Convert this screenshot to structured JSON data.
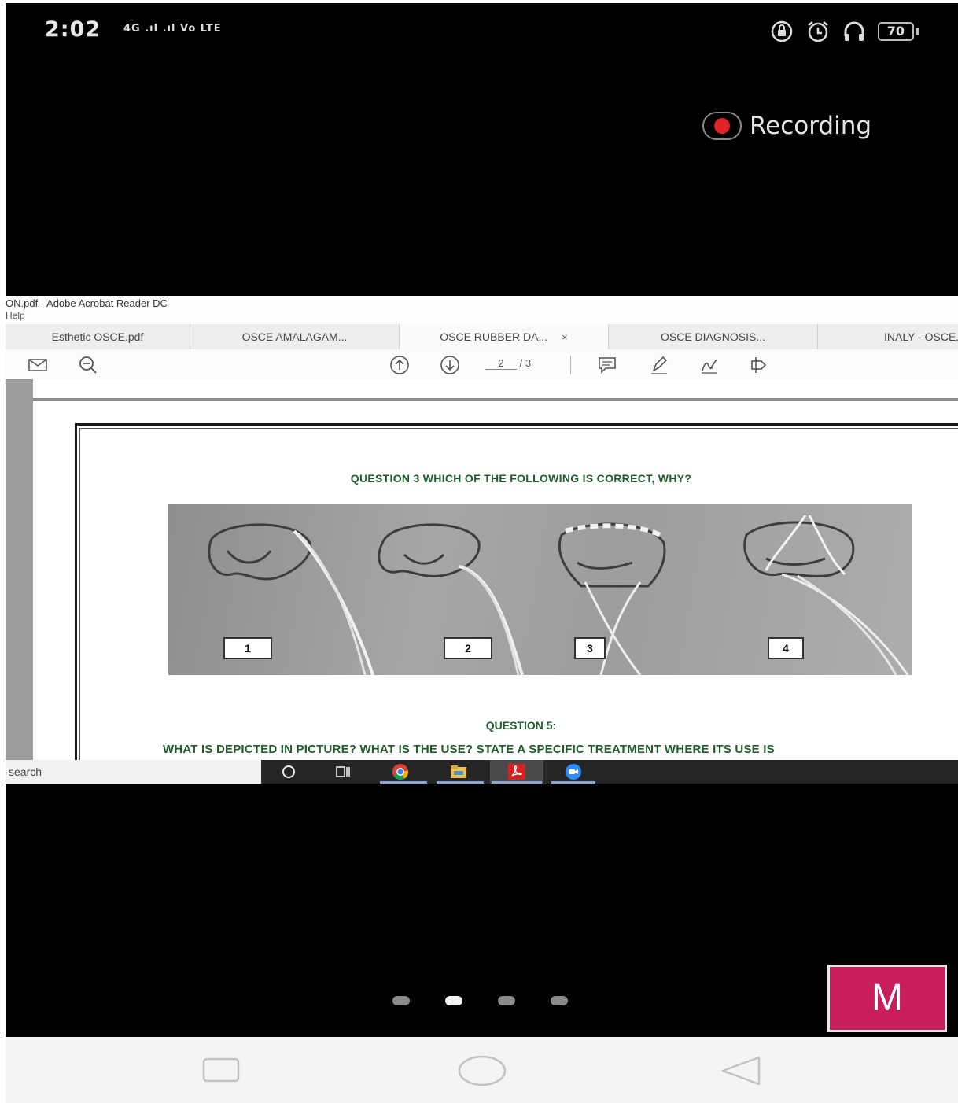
{
  "status_bar": {
    "time": "2:02",
    "signal_text": "4G .ıl .ıl Vo LTE",
    "battery": "70"
  },
  "recording": {
    "label": "Recording",
    "dot_color": "#e02424"
  },
  "window": {
    "title": "ON.pdf - Adobe Acrobat Reader DC",
    "menu": "Help"
  },
  "tabs": [
    {
      "label": "Esthetic OSCE.pdf"
    },
    {
      "label": "OSCE AMALAGAM..."
    },
    {
      "label": "OSCE RUBBER DA...",
      "active": true,
      "close": "×"
    },
    {
      "label": "OSCE DIAGNOSIS..."
    },
    {
      "label": "INALY - OSCE..."
    }
  ],
  "toolbar": {
    "icons": [
      "mail-icon",
      "zoom-out-icon",
      "page-up-icon",
      "page-down-icon",
      "comment-icon",
      "highlight-icon",
      "sign-icon",
      "share-icon"
    ],
    "current_page": "2",
    "total_pages": "/ 3"
  },
  "document": {
    "question3": "QUESTION 3 WHICH OF THE FOLLOWING IS CORRECT, WHY?",
    "image_labels": [
      "1",
      "2",
      "3",
      "4"
    ],
    "question5_title": "QUESTION 5:",
    "question5_text": "WHAT IS DEPICTED IN PICTURE? WHAT IS THE USE? STATE A SPECIFIC TREATMENT WHERE ITS USE IS"
  },
  "taskbar": {
    "search_placeholder": "search",
    "icons": [
      "cortana-icon",
      "task-view-icon",
      "chrome-icon",
      "file-explorer-icon",
      "acrobat-icon",
      "zoom-icon"
    ]
  },
  "pager": {
    "count": 4,
    "active_index": 1
  },
  "participant": {
    "initial": "M",
    "color": "#c81e5c"
  },
  "nav_bar": {
    "buttons": [
      "recents-button",
      "home-button",
      "back-button"
    ]
  }
}
